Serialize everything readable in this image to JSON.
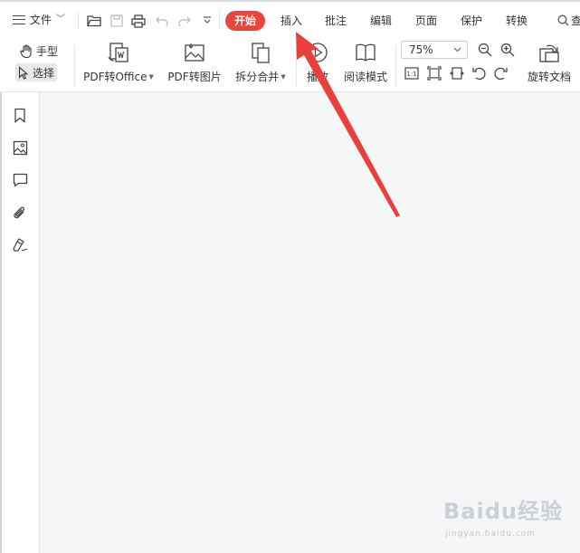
{
  "menubar": {
    "file_label": "文件",
    "tabs": [
      {
        "label": "开始",
        "active": true
      },
      {
        "label": "插入",
        "active": false
      },
      {
        "label": "批注",
        "active": false
      },
      {
        "label": "编辑",
        "active": false
      },
      {
        "label": "页面",
        "active": false
      },
      {
        "label": "保护",
        "active": false
      },
      {
        "label": "转换",
        "active": false
      }
    ],
    "search_partial": "查"
  },
  "ribbon": {
    "hand_label": "手型",
    "select_label": "选择",
    "pdf_to_office_label": "PDF转Office",
    "pdf_to_image_label": "PDF转图片",
    "split_merge_label": "拆分合并",
    "play_label": "播放",
    "reading_mode_label": "阅读模式",
    "zoom_value": "75%",
    "actual_size_label": "1:1",
    "rotate_doc_label": "旋转文档"
  },
  "colors": {
    "accent": "#e8453c",
    "annotation_arrow": "#e8403a",
    "canvas": "#f5f6f8"
  },
  "sidebar": {
    "icons": [
      "bookmark-icon",
      "image-thumbnail-icon",
      "comment-icon",
      "attachment-icon",
      "signature-icon"
    ]
  },
  "watermark": {
    "brand": "Baidu经验",
    "url": "jingyan.baidu.com"
  }
}
